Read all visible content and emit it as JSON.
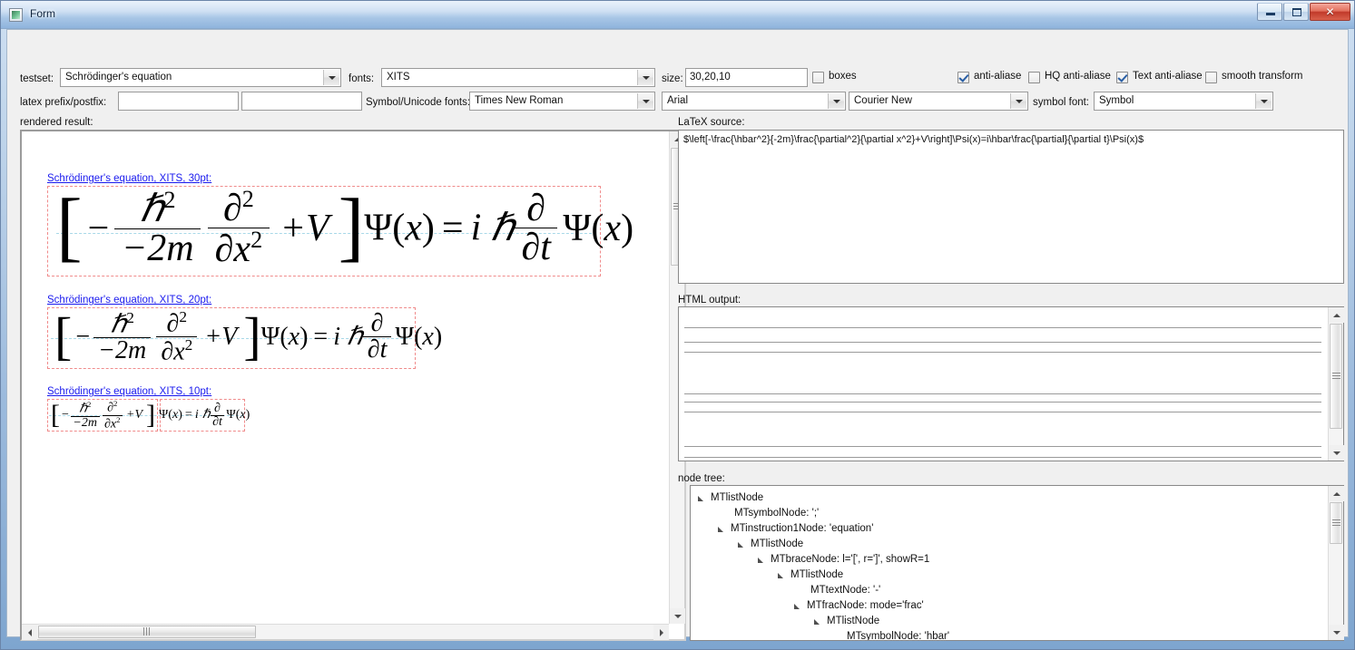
{
  "window": {
    "title": "Form",
    "icon": "form-app-icon",
    "buttons": {
      "minimize": "minimize-button",
      "maximize": "maximize-button",
      "close": "✕"
    }
  },
  "toolbar": {
    "testset_label": "testset:",
    "testset_value": "Schrödinger's equation",
    "fonts_label": "fonts:",
    "fonts_value": "XITS",
    "size_label": "size:",
    "size_value": "30,20,10",
    "checkboxes": [
      {
        "name": "boxes",
        "label": "boxes",
        "checked": false
      },
      {
        "name": "anti-aliase",
        "label": "anti-aliase",
        "checked": true
      },
      {
        "name": "hq-anti-aliase",
        "label": "HQ anti-aliase",
        "checked": false
      },
      {
        "name": "text-anti-aliase",
        "label": "Text anti-aliase",
        "checked": true
      },
      {
        "name": "smooth-transform",
        "label": "smooth transform",
        "checked": false
      }
    ],
    "latex_prefix_postfix_label": "latex prefix/postfix:",
    "latex_prefix_value": "",
    "latex_postfix_value": "",
    "latex_prefix_placeholder": "",
    "latex_postfix_placeholder": "",
    "symbol_unicode_fonts_label": "Symbol/Unicode fonts:",
    "symbol_unicode_font_1": "Times New Roman",
    "symbol_unicode_font_2": "Arial",
    "symbol_unicode_font_3": "Courier New",
    "symbol_font_label": "symbol font:",
    "symbol_font_value": "Symbol"
  },
  "left": {
    "rendered_result_label": "rendered result:",
    "equations": [
      {
        "caption": "Schrödinger's equation, XITS, 30pt:",
        "size": "30pt"
      },
      {
        "caption": "Schrödinger's equation, XITS, 20pt:",
        "size": "20pt"
      },
      {
        "caption": "Schrödinger's equation, XITS, 10pt:",
        "size": "10pt"
      }
    ],
    "equation_parts": {
      "minus": "−",
      "hbar": "ℏ",
      "two": "2",
      "den_left": "−2m",
      "partial": "∂",
      "den_right": "∂x",
      "plus_v": "+V",
      "bracket_left": "[",
      "bracket_right": "]",
      "psi_x": "Ψ(x)",
      "equals": "=",
      "i": "i",
      "dt_num": "∂",
      "dt_den": "∂t"
    }
  },
  "right": {
    "latex_source_label": "LaTeX source:",
    "latex_source_value": "$\\left[-\\frac{\\hbar^2}{-2m}\\frac{\\partial^2}{\\partial x^2}+V\\right]\\Psi(x)=i\\hbar\\frac{\\partial}{\\partial t}\\Psi(x)$",
    "html_output_label": "HTML output:",
    "html_output_rules": 7,
    "node_tree_label": "node tree:",
    "node_tree": [
      {
        "indent": 0,
        "expander": true,
        "text": "MTlistNode"
      },
      {
        "indent": 1,
        "expander": false,
        "text": "MTsymbolNode: ';'"
      },
      {
        "indent": 1,
        "expander": true,
        "text": "MTinstruction1Node: 'equation'"
      },
      {
        "indent": 2,
        "expander": true,
        "text": "MTlistNode"
      },
      {
        "indent": 3,
        "expander": true,
        "text": "MTbraceNode: l='[', r=']', showR=1"
      },
      {
        "indent": 4,
        "expander": true,
        "text": "MTlistNode"
      },
      {
        "indent": 5,
        "expander": false,
        "text": "MTtextNode: '-'"
      },
      {
        "indent": 5,
        "expander": true,
        "text": "MTfracNode: mode='frac'"
      },
      {
        "indent": 6,
        "expander": true,
        "text": "MTlistNode"
      },
      {
        "indent": 7,
        "expander": false,
        "text": "MTsymbolNode: 'hbar'"
      }
    ]
  },
  "colors": {
    "accent": "#2a5fa5",
    "caption_link": "#1a1aee",
    "bbox_dashed": "#f08b8b",
    "baseline_dashed": "#a8d8e8",
    "client_bg": "#f0f0f0",
    "title_close": "#c1392a"
  }
}
